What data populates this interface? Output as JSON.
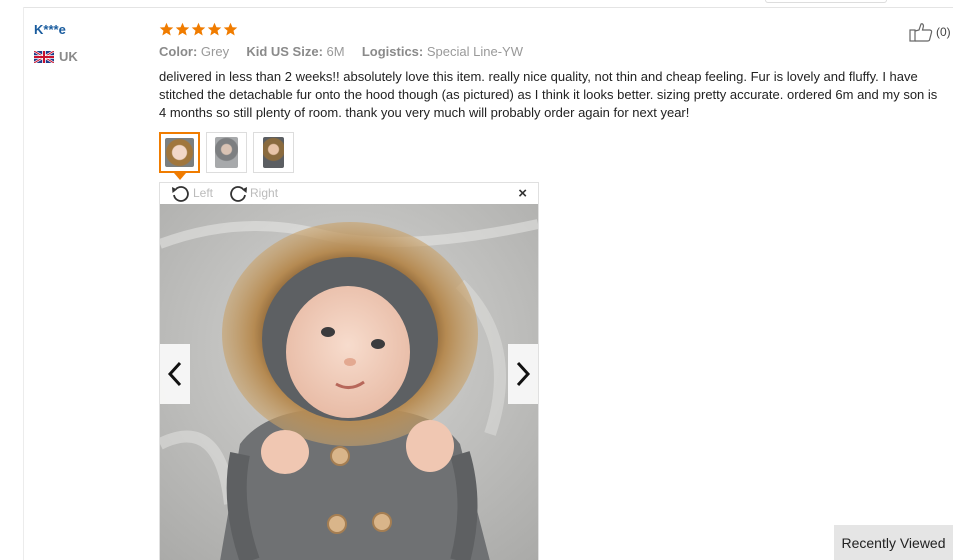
{
  "reviewer": {
    "name": "K***e",
    "country": "UK",
    "flag_icon": "uk-flag-icon"
  },
  "review": {
    "rating": 5,
    "rating_max": 5,
    "star_color": "#f07c00",
    "attributes": [
      {
        "label": "Color:",
        "value": "Grey"
      },
      {
        "label": "Kid US Size:",
        "value": "6M"
      },
      {
        "label": "Logistics:",
        "value": "Special Line-YW"
      }
    ],
    "text": "delivered in less than 2 weeks!! absolutely love this item. really nice quality, not thin and cheap feeling. Fur is lovely and fluffy. I have stitched the detachable fur onto the hood though (as pictured) as I think it looks better. sizing pretty accurate. ordered 6m and my son is 4 months so still plenty of room. thank you very much will probably order again for next year!",
    "helpful_count": "(0)",
    "helpful_icon": "thumbs-up-icon"
  },
  "photos": {
    "thumbnail_count": 3,
    "active_index": 0,
    "accent_color": "#f07c00"
  },
  "viewer": {
    "rotate_left_label": "Left",
    "rotate_right_label": "Right",
    "close_glyph": "×",
    "prev_icon": "chevron-left-icon",
    "next_icon": "chevron-right-icon"
  },
  "recently_viewed": {
    "label": "Recently Viewed"
  }
}
